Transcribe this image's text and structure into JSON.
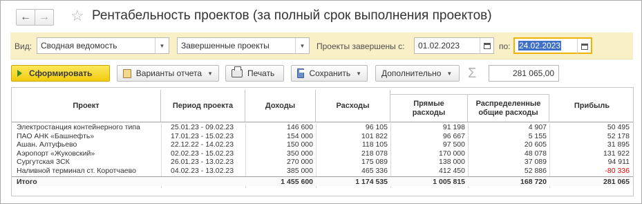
{
  "window": {
    "title": "Рентабельность проектов (за полный срок выполнения проектов)",
    "back_glyph": "←",
    "forward_glyph": "→",
    "favorite_glyph": "☆"
  },
  "filters": {
    "view_label": "Вид:",
    "view_value": "Сводная ведомость",
    "status_value": "Завершенные проекты",
    "completed_from_label": "Проекты завершены с:",
    "date_from": "01.02.2023",
    "to_label": "по:",
    "date_to": "24.02.2023"
  },
  "toolbar": {
    "generate_label": "Сформировать",
    "variants_label": "Варианты отчета",
    "print_label": "Печать",
    "save_label": "Сохранить",
    "more_label": "Дополнительно",
    "sigma_glyph": "Σ",
    "sum_value": "281 065,00",
    "caret_glyph": "▼"
  },
  "report": {
    "columns": {
      "project": "Проект",
      "period": "Период проекта",
      "income": "Доходы",
      "expenses": "Расходы",
      "direct": "Прямые\nрасходы",
      "allocated": "Распределенные\nобщие расходы",
      "profit": "Прибыль"
    },
    "rows": [
      {
        "project": "Электростанция контейнерного типа",
        "period": "25.01.23 - 09.02.23",
        "income": "146 600",
        "expenses": "96 105",
        "direct": "91 198",
        "allocated": "4 907",
        "profit": "50 495"
      },
      {
        "project": "ПАО АНК «Башнефть»",
        "period": "17.01.23 - 15.02.23",
        "income": "154 000",
        "expenses": "101 822",
        "direct": "96 667",
        "allocated": "5 155",
        "profit": "52 178"
      },
      {
        "project": "Ашан. Алтуфьево",
        "period": "22.12.22 - 14.02.23",
        "income": "150 000",
        "expenses": "118 105",
        "direct": "97 500",
        "allocated": "20 605",
        "profit": "31 895"
      },
      {
        "project": "Аэропорт «Жуковский»",
        "period": "02.02.23 - 15.02.23",
        "income": "350 000",
        "expenses": "218 078",
        "direct": "170 000",
        "allocated": "48 078",
        "profit": "131 922"
      },
      {
        "project": "Сургутская ЗСК",
        "period": "26.01.23 - 13.02.23",
        "income": "270 000",
        "expenses": "175 089",
        "direct": "138 000",
        "allocated": "37 089",
        "profit": "94 911"
      },
      {
        "project": "Наливной терминал ст. Коротчаево",
        "period": "04.02.23 - 13.02.23",
        "income": "385 000",
        "expenses": "465 336",
        "direct": "412 450",
        "allocated": "52 886",
        "profit": "-80 336"
      }
    ],
    "total": {
      "label": "Итого",
      "income": "1 455 600",
      "expenses": "1 174 535",
      "direct": "1 005 815",
      "allocated": "168 720",
      "profit": "281 065"
    },
    "negative_color": "#e60000"
  }
}
